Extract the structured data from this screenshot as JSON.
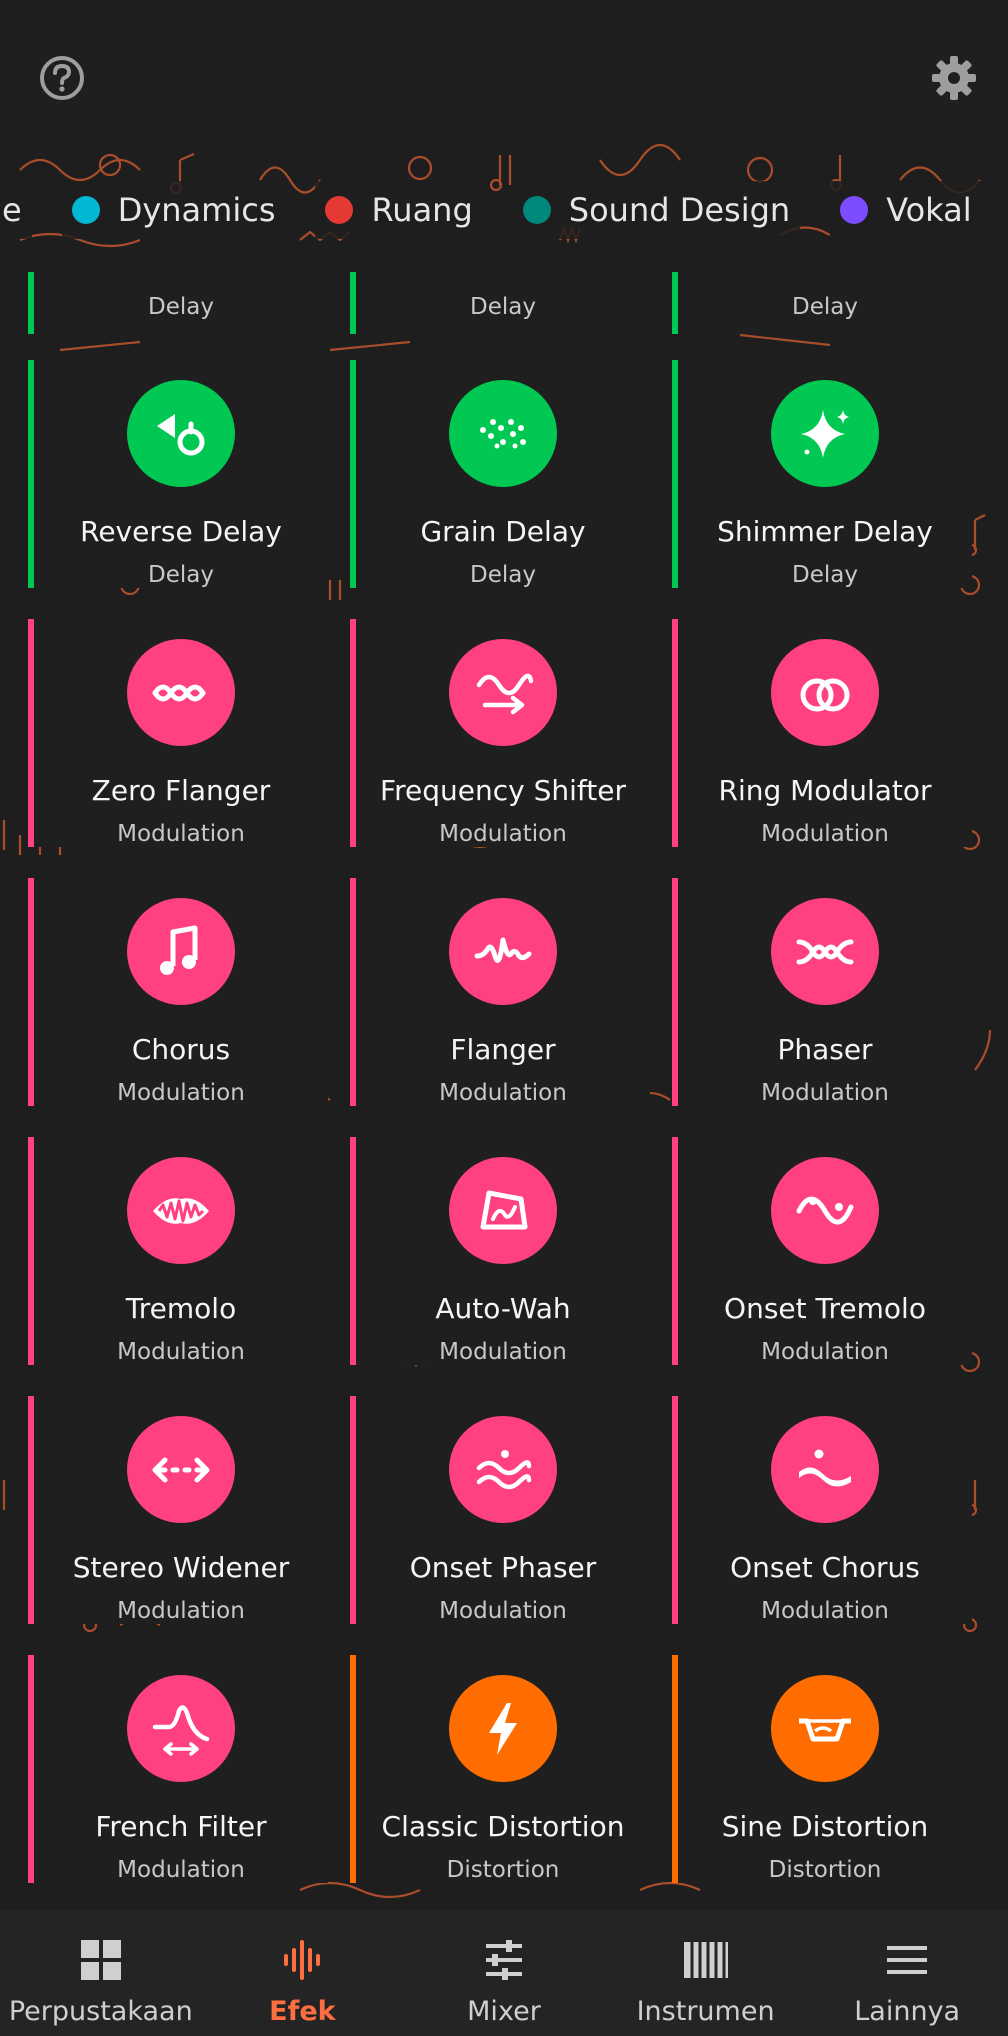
{
  "colors": {
    "delay": "#00c853",
    "modulation": "#ff4081",
    "distortion": "#ff6d00",
    "accent": "#ff6e40"
  },
  "topbar": {
    "help_icon": "help-circle-icon",
    "settings_icon": "gear-icon"
  },
  "chips": [
    {
      "label": "e",
      "color": "#ff6d00"
    },
    {
      "label": "Dynamics",
      "color": "#00b8d4"
    },
    {
      "label": "Ruang",
      "color": "#e53935"
    },
    {
      "label": "Sound Design",
      "color": "#00897b"
    },
    {
      "label": "Vokal",
      "color": "#7c4dff"
    }
  ],
  "partial_row": [
    "Delay",
    "Delay",
    "Delay"
  ],
  "effects": [
    {
      "name": "Reverse Delay",
      "category": "Delay",
      "icon": "reverse-delay-icon"
    },
    {
      "name": "Grain Delay",
      "category": "Delay",
      "icon": "grain-delay-icon"
    },
    {
      "name": "Shimmer Delay",
      "category": "Delay",
      "icon": "shimmer-delay-icon"
    },
    {
      "name": "Zero Flanger",
      "category": "Modulation",
      "icon": "zero-flanger-icon"
    },
    {
      "name": "Frequency Shifter",
      "category": "Modulation",
      "icon": "frequency-shifter-icon"
    },
    {
      "name": "Ring Modulator",
      "category": "Modulation",
      "icon": "ring-modulator-icon"
    },
    {
      "name": "Chorus",
      "category": "Modulation",
      "icon": "chorus-icon"
    },
    {
      "name": "Flanger",
      "category": "Modulation",
      "icon": "flanger-icon"
    },
    {
      "name": "Phaser",
      "category": "Modulation",
      "icon": "phaser-icon"
    },
    {
      "name": "Tremolo",
      "category": "Modulation",
      "icon": "tremolo-icon"
    },
    {
      "name": "Auto-Wah",
      "category": "Modulation",
      "icon": "auto-wah-icon"
    },
    {
      "name": "Onset Tremolo",
      "category": "Modulation",
      "icon": "onset-tremolo-icon"
    },
    {
      "name": "Stereo Widener",
      "category": "Modulation",
      "icon": "stereo-widener-icon"
    },
    {
      "name": "Onset Phaser",
      "category": "Modulation",
      "icon": "onset-phaser-icon"
    },
    {
      "name": "Onset Chorus",
      "category": "Modulation",
      "icon": "onset-chorus-icon"
    },
    {
      "name": "French Filter",
      "category": "Modulation",
      "icon": "french-filter-icon"
    },
    {
      "name": "Classic Distortion",
      "category": "Distortion",
      "icon": "classic-distortion-icon"
    },
    {
      "name": "Sine Distortion",
      "category": "Distortion",
      "icon": "sine-distortion-icon"
    }
  ],
  "nav": {
    "items": [
      {
        "label": "Perpustakaan",
        "icon": "library-grid-icon"
      },
      {
        "label": "Efek",
        "icon": "effects-waveform-icon",
        "active": true
      },
      {
        "label": "Mixer",
        "icon": "mixer-sliders-icon"
      },
      {
        "label": "Instrumen",
        "icon": "piano-keys-icon"
      },
      {
        "label": "Lainnya",
        "icon": "menu-icon"
      }
    ]
  }
}
